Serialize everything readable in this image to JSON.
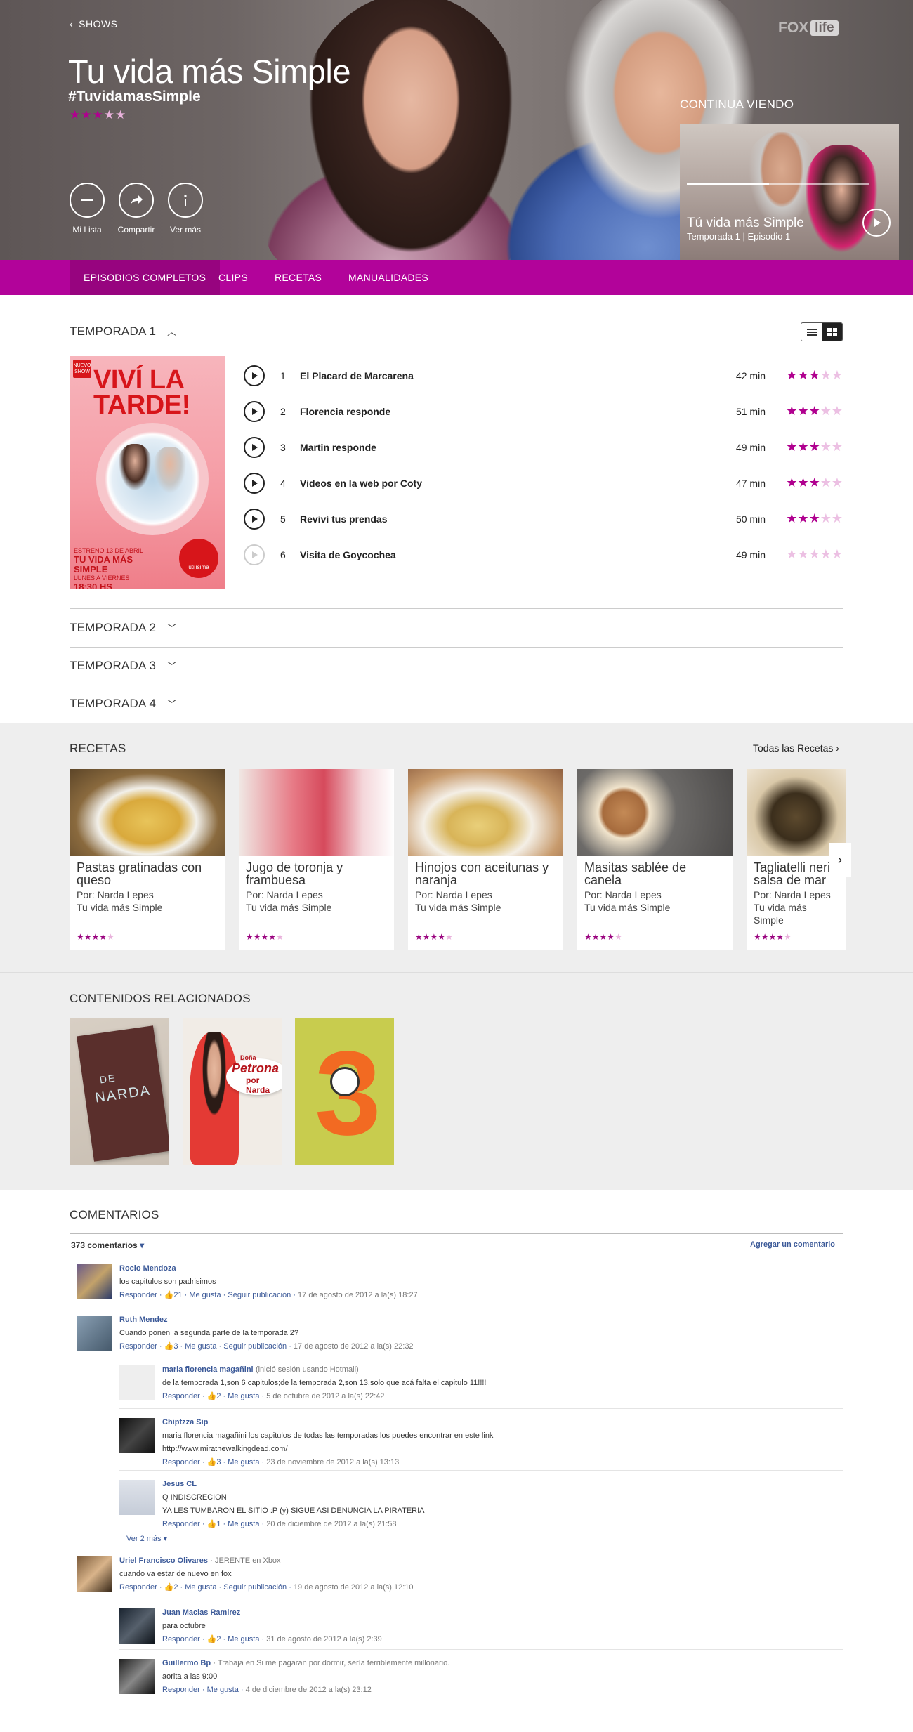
{
  "hero": {
    "back_label": "SHOWS",
    "title": "Tu vida más Simple",
    "hashtag": "#TuvidamasSimple",
    "rating": 3,
    "actions": [
      {
        "label": "Mi Lista",
        "icon": "minus-icon"
      },
      {
        "label": "Compartir",
        "icon": "share-arrow-icon"
      },
      {
        "label": "Ver más",
        "icon": "info-icon"
      }
    ],
    "logo": {
      "fox": "FOX",
      "life": "life"
    },
    "continue": {
      "label": "CONTINUA VIENDO",
      "title": "Tú vida más Simple",
      "subtitle": "Temporada 1 | Episodio 1",
      "progress": 0.45
    }
  },
  "tabs": [
    "EPISODIOS COMPLETOS",
    "CLIPS",
    "RECETAS",
    "MANUALIDADES"
  ],
  "seasons": {
    "open": {
      "label": "TEMPORADA 1",
      "poster": {
        "badge": "NUEVO SHOW",
        "headline": "VIVÍ LA TARDE!",
        "small": "ESTRENO 13 DE ABRIL",
        "show": "TU VIDA MÁS SIMPLE",
        "days": "LUNES A VIERNES",
        "time": "18:30 HS",
        "brand": "utilísima"
      },
      "episodes": [
        {
          "num": "1",
          "name": "El Placard de Marcarena",
          "dur": "42 min",
          "rating": 3,
          "available": true
        },
        {
          "num": "2",
          "name": "Florencia responde",
          "dur": "51 min",
          "rating": 3,
          "available": true
        },
        {
          "num": "3",
          "name": "Martin responde",
          "dur": "49 min",
          "rating": 3,
          "available": true
        },
        {
          "num": "4",
          "name": "Videos en la web por Coty",
          "dur": "47 min",
          "rating": 3,
          "available": true
        },
        {
          "num": "5",
          "name": "Reviví tus prendas",
          "dur": "50 min",
          "rating": 3,
          "available": true
        },
        {
          "num": "6",
          "name": "Visita de Goycochea",
          "dur": "49 min",
          "rating": 0,
          "available": false
        }
      ]
    },
    "closed": [
      "TEMPORADA 2",
      "TEMPORADA 3",
      "TEMPORADA 4"
    ]
  },
  "recetas": {
    "title": "RECETAS",
    "all_link": "Todas las Recetas",
    "items": [
      {
        "title": "Pastas gratinadas con queso",
        "by": "Por: Narda Lepes",
        "show": "Tu vida más Simple",
        "rating": 4
      },
      {
        "title": "Jugo de toronja y frambuesa",
        "by": "Por: Narda Lepes",
        "show": "Tu vida más Simple",
        "rating": 4
      },
      {
        "title": "Hinojos con aceitunas y naranja",
        "by": "Por: Narda Lepes",
        "show": "Tu vida más Simple",
        "rating": 4
      },
      {
        "title": "Masitas sablée de canela",
        "by": "Por: Narda Lepes",
        "show": "Tu vida más Simple",
        "rating": 4
      },
      {
        "title": "Tagliatelli neri salsa de mar",
        "by": "Por: Narda Lepes",
        "show": "Tu vida más Simple",
        "rating": 4
      }
    ]
  },
  "related": {
    "title": "CONTENIDOS RELACIONADOS",
    "items": [
      {
        "name": "De Narda",
        "text1": "DE",
        "text2": "NARDA"
      },
      {
        "name": "Doña Petrona por Narda",
        "text1": "Doña",
        "text2": "Petrona",
        "text3": "por Narda"
      },
      {
        "name": "Show 3",
        "text1": "3"
      }
    ]
  },
  "comments": {
    "title": "COMENTARIOS",
    "count": "373 comentarios",
    "add": "Agregar un comentario",
    "more": "Ver 2 más",
    "list": [
      {
        "who": "Rocio Mendoza",
        "extra": "",
        "text": "los capitulos son padrisimos",
        "text2": "",
        "likes": "21",
        "follow": true,
        "date": "17 de agosto de 2012 a la(s) 18:27",
        "reply": false
      },
      {
        "who": "Ruth Mendez",
        "extra": "",
        "text": "Cuando ponen la segunda parte de la temporada 2?",
        "text2": "",
        "likes": "3",
        "follow": true,
        "date": "17 de agosto de 2012 a la(s) 22:32",
        "reply": false
      },
      {
        "who": "maria florencia magañini",
        "extra": "(inició sesión usando Hotmail)",
        "text": "de la temporada 1,son 6 capitulos;de la temporada 2,son 13,solo que acá falta el capitulo 11!!!!",
        "text2": "",
        "likes": "2",
        "follow": false,
        "date": "5 de octubre de 2012 a la(s) 22:42",
        "reply": true
      },
      {
        "who": "Chiptzza Sip",
        "extra": "",
        "text": "maria florencia magañini los capitulos de todas las temporadas los puedes encontrar en este link",
        "text2": "http://www.mirathewalkingdead.com/",
        "likes": "3",
        "follow": false,
        "date": "23 de noviembre de 2012 a la(s) 13:13",
        "reply": true
      },
      {
        "who": "Jesus CL",
        "extra": "",
        "text": "Q INDISCRECION",
        "text2": "YA LES TUMBARON EL SITIO :P (y) SIGUE ASI DENUNCIA LA PIRATERIA",
        "likes": "1",
        "follow": false,
        "date": "20 de diciembre de 2012 a la(s) 21:58",
        "reply": true
      },
      {
        "who": "Uriel Francisco Olivares",
        "extra": "· JERENTE en Xbox",
        "text": "cuando va estar de nuevo en fox",
        "text2": "",
        "likes": "2",
        "follow": true,
        "date": "19 de agosto de 2012 a la(s) 12:10",
        "reply": false
      },
      {
        "who": "Juan Macias Ramirez",
        "extra": "",
        "text": "para octubre",
        "text2": "",
        "likes": "2",
        "follow": false,
        "date": "31 de agosto de 2012 a la(s) 2:39",
        "reply": true
      },
      {
        "who": "Guillermo Bp",
        "extra": "· Trabaja en Si me pagaran por dormir, sería terriblemente millonario.",
        "text": "aorita a las 9:00",
        "text2": "",
        "likes": "",
        "follow": false,
        "date": "4 de diciembre de 2012 a la(s) 23:12",
        "reply": true
      }
    ],
    "actions": {
      "reply": "Responder",
      "like": "Me gusta",
      "follow": "Seguir publicación"
    }
  },
  "colors": {
    "accent": "#b2039a",
    "accent_dark": "#97047f",
    "link": "#3b5998"
  }
}
